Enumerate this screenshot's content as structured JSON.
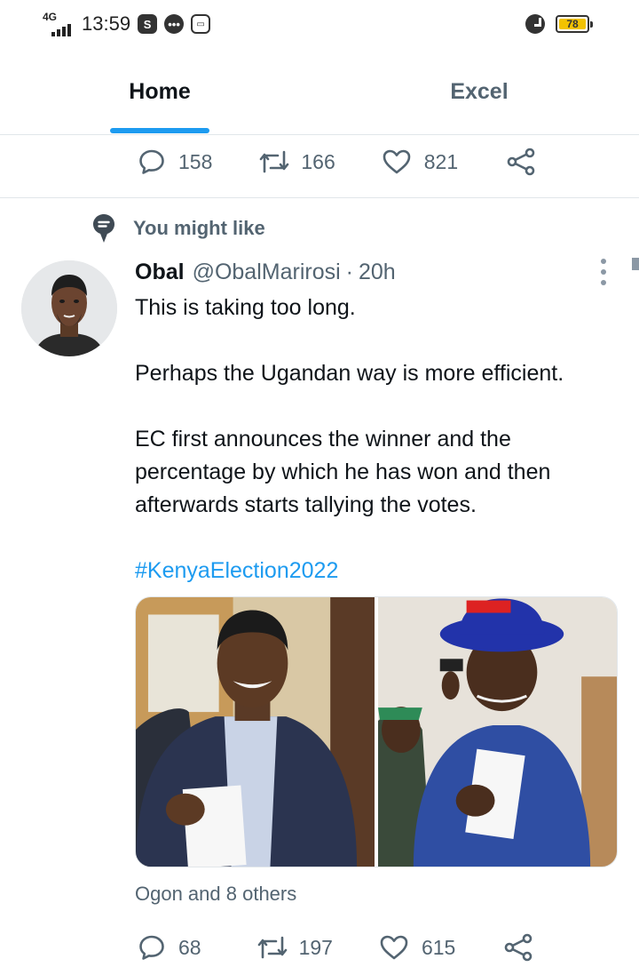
{
  "status_bar": {
    "network": "4G",
    "time": "13:59",
    "app_icons": [
      "shazam-icon",
      "messages-icon",
      "mailbox-icon"
    ],
    "alarm_icon": "alarm-icon",
    "battery": "78"
  },
  "tabs": [
    {
      "label": "Home",
      "selected": true
    },
    {
      "label": "Excel",
      "selected": false
    }
  ],
  "prev_tweet_actions": {
    "replies": "158",
    "retweets": "166",
    "likes": "821"
  },
  "suggestion": {
    "icon": "speech-bubble-icon",
    "label": "You might like"
  },
  "tweet": {
    "name": "Obal",
    "handle": "@ObalMarirosi",
    "separator": "·",
    "time": "20h",
    "lines": [
      "This is taking too long.",
      "Perhaps the Ugandan way is more efficient.",
      "EC first announces the winner and the percentage by which he has won and then afterwards starts tallying the votes."
    ],
    "hashtag": "#KenyaElection2022",
    "liked_by": "Ogon and 8 others",
    "actions": {
      "replies": "68",
      "retweets": "197",
      "likes": "615"
    }
  },
  "colors": {
    "accent": "#1d9bf0",
    "muted": "#536471",
    "text": "#0f1419"
  }
}
